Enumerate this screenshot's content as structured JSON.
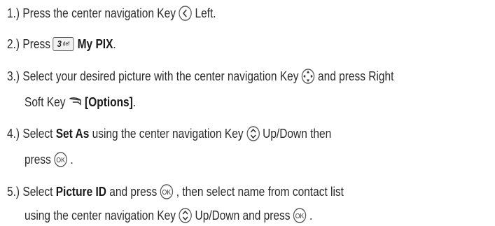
{
  "steps": [
    {
      "num": "1.)",
      "a": "Press the center navigation Key",
      "icon": "nav-left-icon",
      "b": "Left."
    },
    {
      "num": "2.)",
      "a": "Press",
      "key_main": "3",
      "key_sub": "def",
      "bold": "My PIX",
      "end": "."
    },
    {
      "num": "3.)",
      "a": "Select your desired picture with the center navigation Key",
      "icon": "nav-4way-icon",
      "b": "and press Right",
      "cont_a": "Soft Key",
      "cont_icon": "right-soft-key-icon",
      "cont_bold": "[Options]",
      "cont_end": "."
    },
    {
      "num": "4.)",
      "a": "Select",
      "bold": "Set As",
      "b": "using the center navigation Key",
      "icon": "nav-updown-icon",
      "c": "Up/Down then",
      "cont_a": "press",
      "cont_icon": "ok-key-icon",
      "cont_end": "."
    },
    {
      "num": "5.)",
      "a": "Select",
      "bold": "Picture ID",
      "b": "and press",
      "icon": "ok-key-icon",
      "c": ", then select name from contact list",
      "cont_a": "using the center navigation Key",
      "cont_icon": "nav-updown-icon",
      "cont_b": "Up/Down and press",
      "cont_icon2": "ok-key-icon",
      "cont_end": "."
    }
  ]
}
